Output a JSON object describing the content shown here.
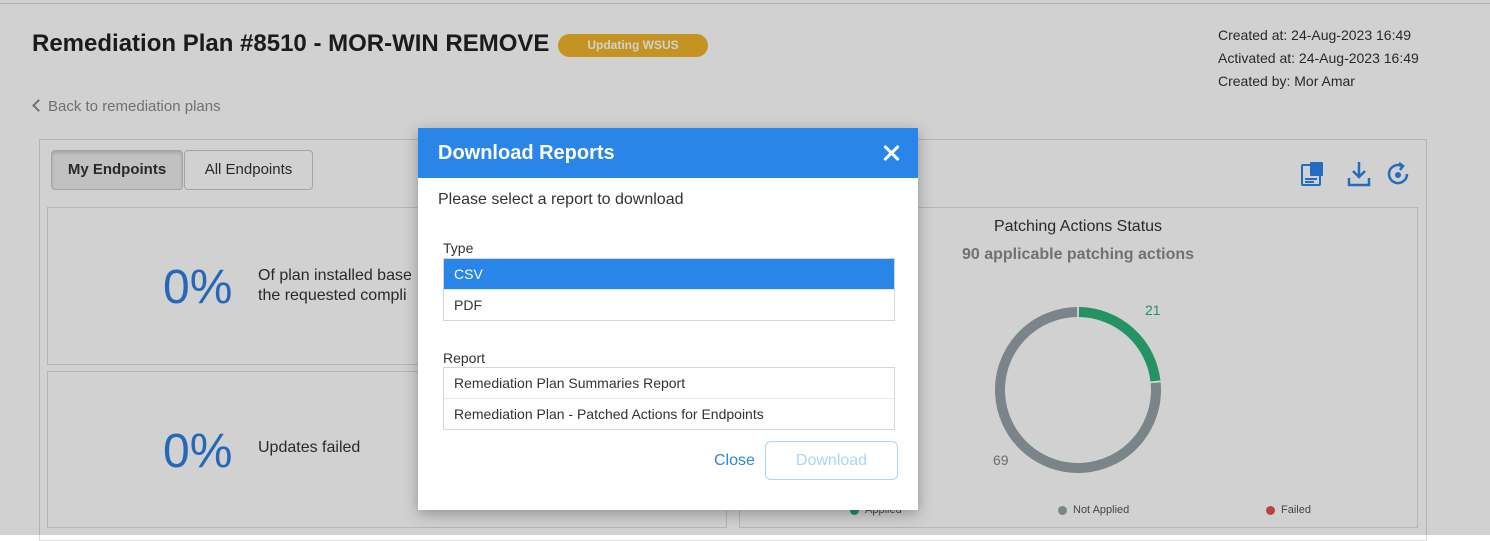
{
  "header": {
    "title": "Remediation Plan #8510 - MOR-WIN REMOVE",
    "status_badge": "Updating WSUS",
    "created_at": "Created at: 24-Aug-2023 16:49",
    "activated_at": "Activated at: 24-Aug-2023 16:49",
    "created_by": "Created by: Mor Amar"
  },
  "nav": {
    "back_label": "Back to remediation plans"
  },
  "tabs": [
    {
      "label": "My Endpoints",
      "active": true
    },
    {
      "label": "All Endpoints",
      "active": false
    }
  ],
  "toolbar": {
    "icons": [
      "report-icon",
      "download-icon",
      "refresh-icon"
    ]
  },
  "cards": {
    "installed": {
      "percent": "0%",
      "text": "Of plan installed base\nthe requested compli"
    },
    "failed": {
      "percent": "0%",
      "text": "Updates failed"
    }
  },
  "patching_status": {
    "title": "Patching Actions Status",
    "subtitle": "90 applicable patching actions",
    "applied_value": "21",
    "not_applied_value": "69",
    "legend": [
      "Applied",
      "Not Applied",
      "Failed"
    ],
    "colors": {
      "applied": "#2db37b",
      "not_applied": "#95a2a8",
      "failed": "#e05555"
    }
  },
  "chart_data": {
    "type": "pie",
    "title": "Patching Actions Status",
    "subtitle": "90 applicable patching actions",
    "categories": [
      "Applied",
      "Not Applied",
      "Failed"
    ],
    "values": [
      21,
      69,
      0
    ],
    "colors": [
      "#2db37b",
      "#95a2a8",
      "#e05555"
    ],
    "legend_position": "bottom"
  },
  "modal": {
    "title": "Download Reports",
    "description": "Please select a report to download",
    "type_label": "Type",
    "type_options": [
      "CSV",
      "PDF"
    ],
    "selected_type": "CSV",
    "report_label": "Report",
    "report_options": [
      "Remediation Plan Summaries Report",
      "Remediation Plan - Patched Actions for Endpoints"
    ],
    "close_label": "Close",
    "download_label": "Download",
    "accent": "#2a85e8"
  }
}
